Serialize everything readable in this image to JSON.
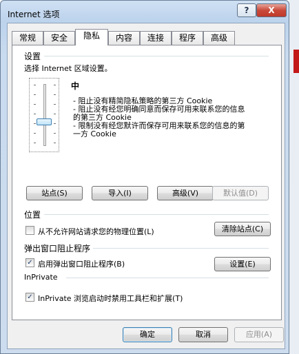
{
  "window": {
    "title": "Internet 选项",
    "help_label": "?",
    "close_label": "X"
  },
  "tabs": [
    {
      "label": "常规"
    },
    {
      "label": "安全"
    },
    {
      "label": "隐私"
    },
    {
      "label": "内容"
    },
    {
      "label": "连接"
    },
    {
      "label": "程序"
    },
    {
      "label": "高级"
    }
  ],
  "active_tab": "隐私",
  "settings": {
    "title": "设置",
    "instruction": "选择 Internet 区域设置。",
    "level": "中",
    "desc_lines": [
      "- 阻止没有精简隐私策略的第三方 Cookie",
      "- 阻止没有经您明确同意而保存可用来联系您的信息",
      "的第三方 Cookie",
      "- 限制没有经您默许而保存可用来联系您的信息的第",
      "一方 Cookie"
    ],
    "slider_level_index": 2,
    "buttons": {
      "sites": "站点(S)",
      "import": "导入(I)",
      "advanced": "高级(V)",
      "default": "默认值(D)"
    }
  },
  "location": {
    "title": "位置",
    "checkbox_label": "从不允许网站请求您的物理位置(L)",
    "checked": false,
    "clear_sites": "清除站点(C)"
  },
  "popup": {
    "title": "弹出窗口阻止程序",
    "checkbox_label": "启用弹出窗口阻止程序(B)",
    "checked": true,
    "settings_button": "设置(E)"
  },
  "inprivate": {
    "title": "InPrivate",
    "checkbox_label": "InPrivate 浏览启动时禁用工具栏和扩展(T)",
    "checked": true
  },
  "footer": {
    "ok": "确定",
    "cancel": "取消",
    "apply": "应用(A)"
  }
}
